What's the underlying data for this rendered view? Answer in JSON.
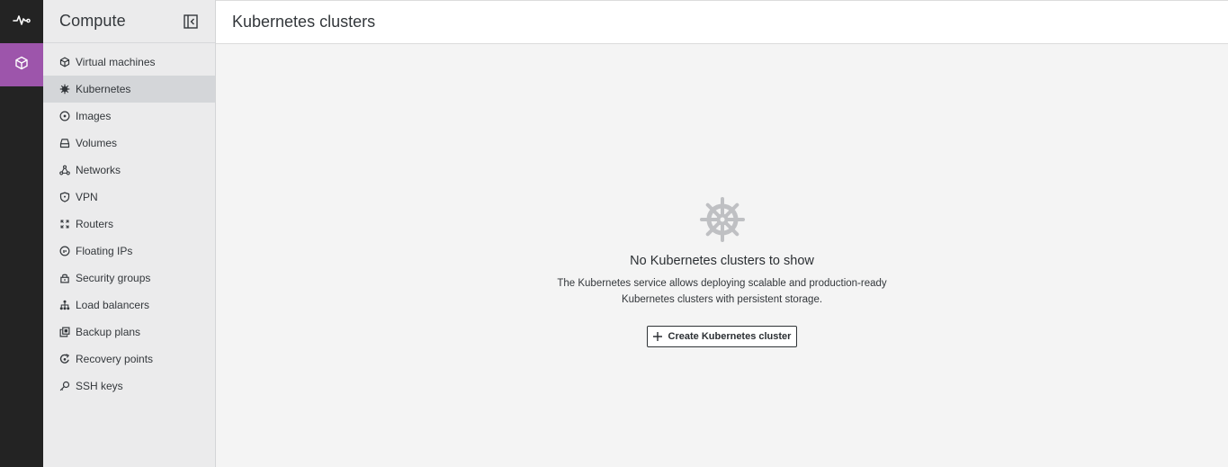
{
  "rail": {
    "items": [
      {
        "name": "activity",
        "icon": "pulse-icon",
        "active": false
      },
      {
        "name": "compute",
        "icon": "cube-icon",
        "active": true
      }
    ]
  },
  "sidebar": {
    "title": "Compute",
    "items": [
      {
        "label": "Virtual machines",
        "icon": "cube-icon"
      },
      {
        "label": "Kubernetes",
        "icon": "helm-wheel-icon",
        "active": true
      },
      {
        "label": "Images",
        "icon": "disc-icon"
      },
      {
        "label": "Volumes",
        "icon": "drive-icon"
      },
      {
        "label": "Networks",
        "icon": "network-icon"
      },
      {
        "label": "VPN",
        "icon": "shield-icon"
      },
      {
        "label": "Routers",
        "icon": "router-icon"
      },
      {
        "label": "Floating IPs",
        "icon": "ip-icon"
      },
      {
        "label": "Security groups",
        "icon": "lock-icon"
      },
      {
        "label": "Load balancers",
        "icon": "hierarchy-icon"
      },
      {
        "label": "Backup plans",
        "icon": "copy-icon"
      },
      {
        "label": "Recovery points",
        "icon": "restore-icon"
      },
      {
        "label": "SSH keys",
        "icon": "key-icon"
      }
    ]
  },
  "main": {
    "title": "Kubernetes clusters",
    "empty": {
      "title": "No Kubernetes clusters to show",
      "desc_line1": "The Kubernetes service allows deploying scalable and production-ready",
      "desc_line2": "Kubernetes clusters with persistent storage.",
      "button_label": "Create Kubernetes cluster"
    }
  },
  "colors": {
    "rail_bg": "#232323",
    "rail_active": "#9d55ab",
    "sidebar_bg": "#ebebec",
    "sidebar_active": "#d4d6d9",
    "main_bg": "#f4f4f4"
  }
}
